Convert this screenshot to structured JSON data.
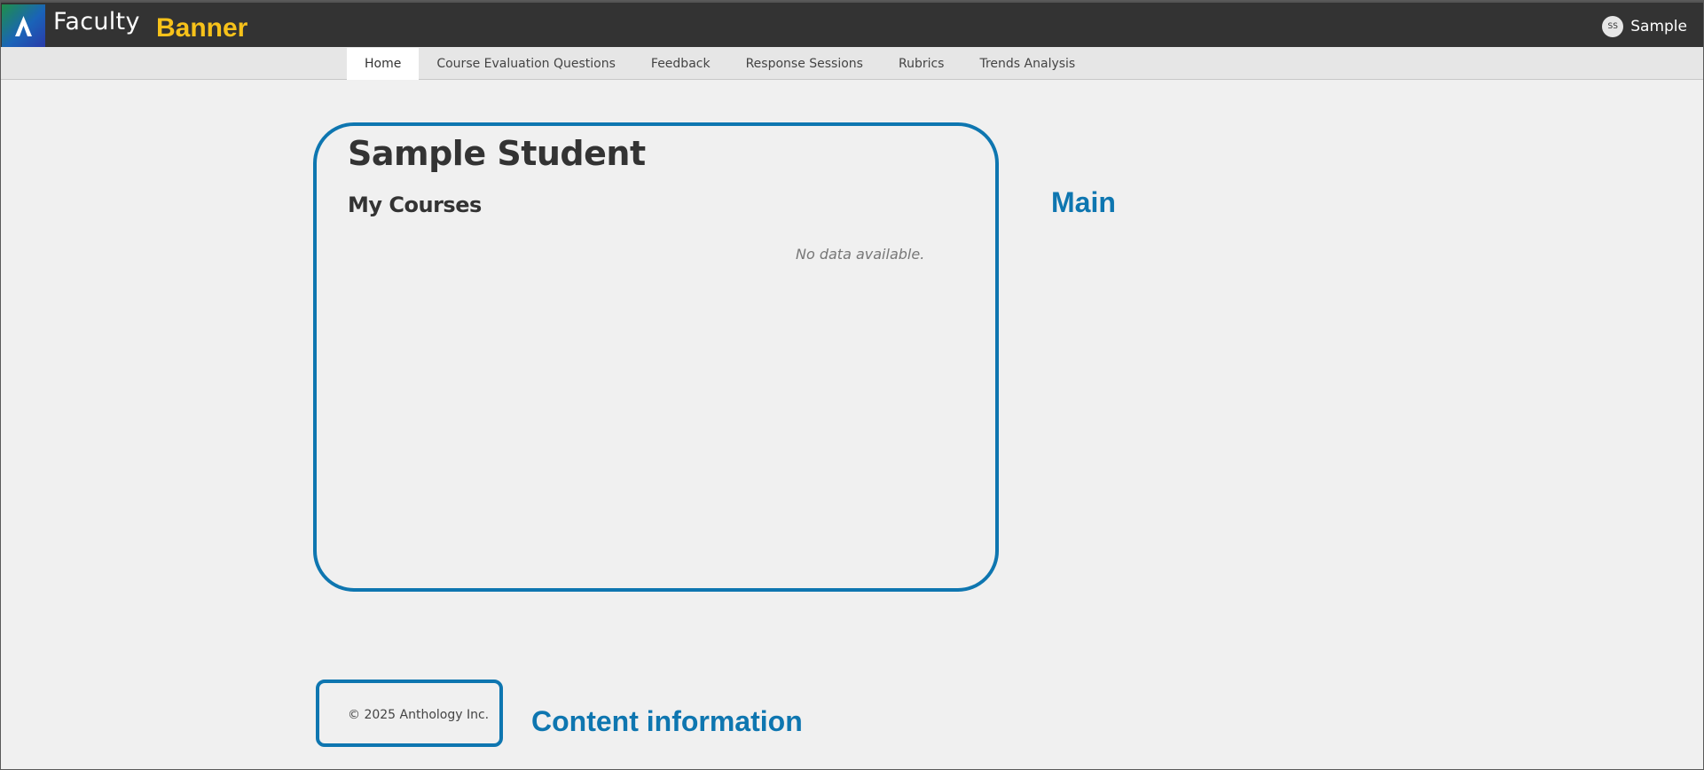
{
  "header": {
    "app_name": "Faculty",
    "region_label": "Banner",
    "user": {
      "initials": "SS",
      "name": "Sample"
    }
  },
  "nav": {
    "items": [
      {
        "label": "Home",
        "active": true
      },
      {
        "label": "Course Evaluation Questions",
        "active": false
      },
      {
        "label": "Feedback",
        "active": false
      },
      {
        "label": "Response Sessions",
        "active": false
      },
      {
        "label": "Rubrics",
        "active": false
      },
      {
        "label": "Trends Analysis",
        "active": false
      }
    ]
  },
  "main": {
    "student_name": "Sample Student",
    "section_title": "My Courses",
    "empty_message": "No data available.",
    "region_label": "Main"
  },
  "footer": {
    "copyright": "© 2025 Anthology Inc.",
    "region_label": "Content information"
  },
  "colors": {
    "topbar": "#333333",
    "banner_accent": "#f7c21a",
    "region_outline": "#0e76b0",
    "page_bg": "#f0f0f0"
  },
  "icons": {
    "logo": "anthology-logo-icon"
  }
}
